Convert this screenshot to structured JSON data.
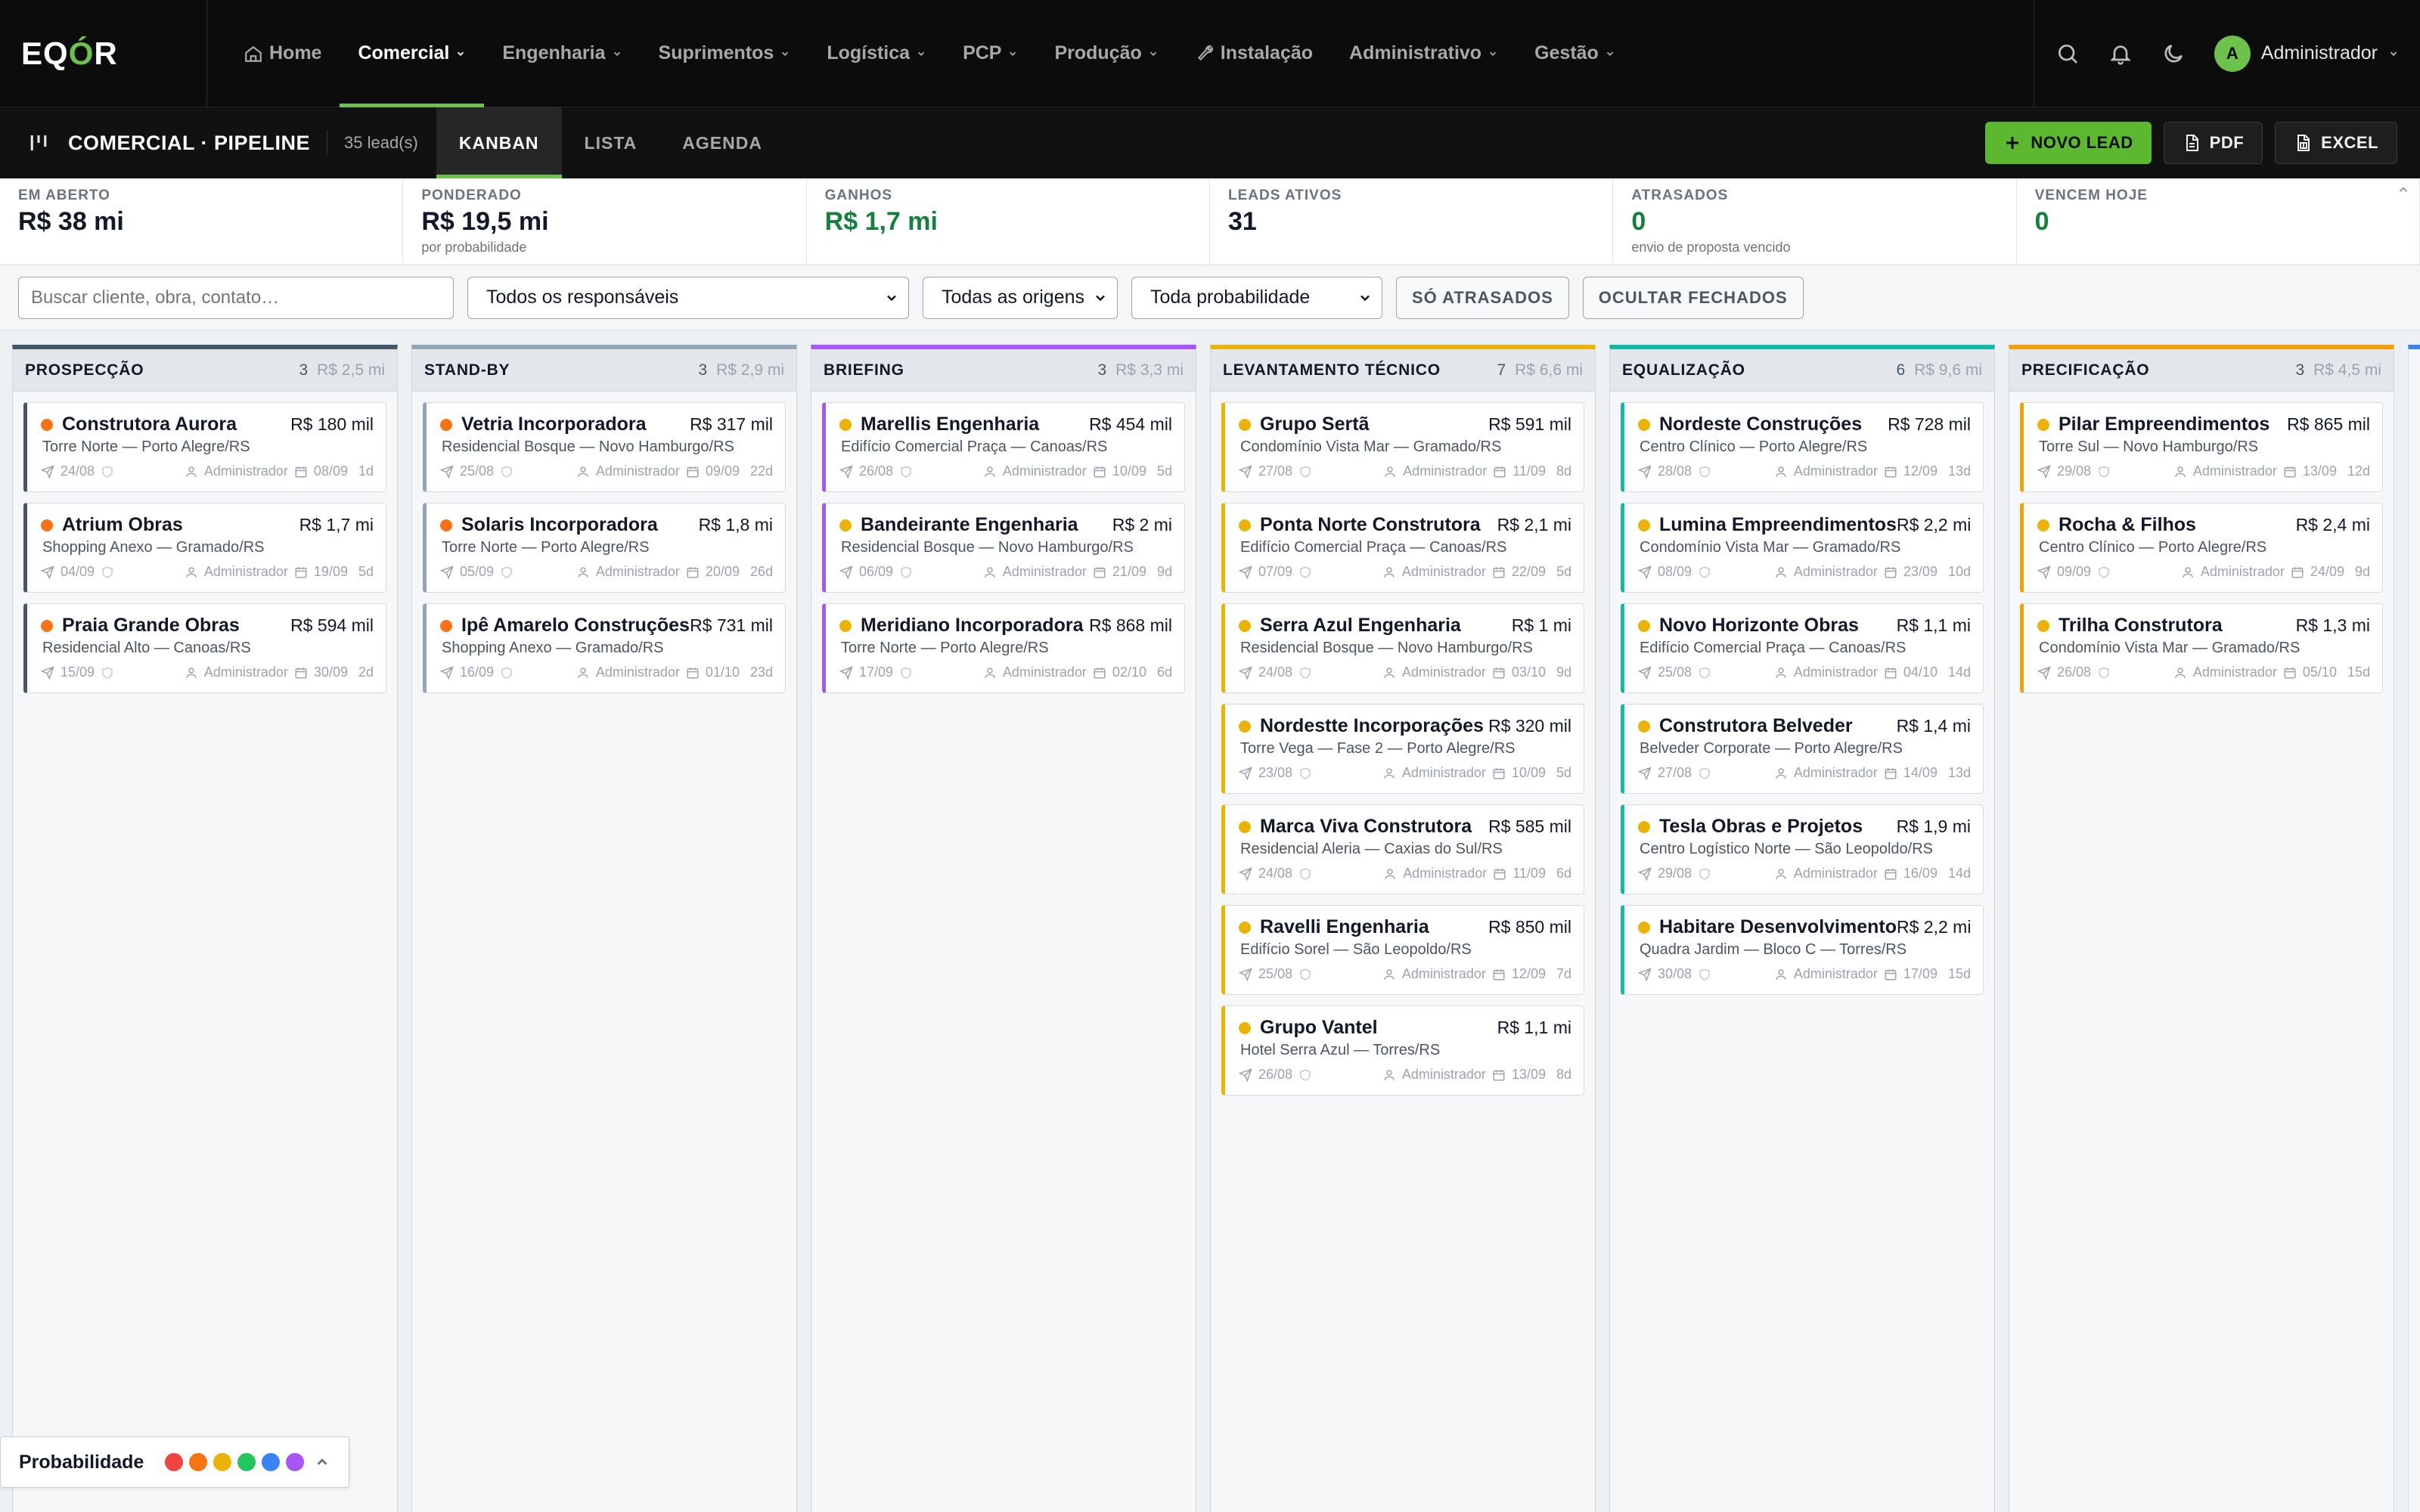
{
  "app": {
    "logo": {
      "part1": "EQ",
      "part2": "Ó",
      "part3": "R"
    },
    "nav": [
      {
        "label": "Home",
        "icon": "home-icon",
        "dropdown": false,
        "active": false
      },
      {
        "label": "Comercial",
        "dropdown": true,
        "active": true
      },
      {
        "label": "Engenharia",
        "dropdown": true,
        "active": false
      },
      {
        "label": "Suprimentos",
        "dropdown": true,
        "active": false
      },
      {
        "label": "Logística",
        "dropdown": true,
        "active": false
      },
      {
        "label": "PCP",
        "dropdown": true,
        "active": false
      },
      {
        "label": "Produção",
        "dropdown": true,
        "active": false
      },
      {
        "label": "Instalação",
        "icon": "wrench-icon",
        "dropdown": false,
        "active": false
      },
      {
        "label": "Administrativo",
        "dropdown": true,
        "active": false
      },
      {
        "label": "Gestão",
        "dropdown": true,
        "active": false
      }
    ],
    "user": {
      "initial": "A",
      "name": "Administrador"
    },
    "accent": "#6cc24a"
  },
  "subheader": {
    "title": "COMERCIAL · PIPELINE",
    "lead_count": "35 lead(s)",
    "tabs": [
      {
        "label": "KANBAN",
        "active": true
      },
      {
        "label": "LISTA",
        "active": false
      },
      {
        "label": "AGENDA",
        "active": false
      }
    ],
    "actions": {
      "new_lead": "NOVO LEAD",
      "pdf": "PDF",
      "excel": "EXCEL"
    }
  },
  "metrics": [
    {
      "label": "EM ABERTO",
      "value": "R$ 38 mi",
      "sub": "",
      "green": false
    },
    {
      "label": "PONDERADO",
      "value": "R$ 19,5 mi",
      "sub": "por probabilidade",
      "green": false
    },
    {
      "label": "GANHOS",
      "value": "R$ 1,7 mi",
      "sub": "",
      "green": true
    },
    {
      "label": "LEADS ATIVOS",
      "value": "31",
      "sub": "",
      "green": false
    },
    {
      "label": "ATRASADOS",
      "value": "0",
      "sub": "envio de proposta vencido",
      "green": true
    },
    {
      "label": "VENCEM HOJE",
      "value": "0",
      "sub": "",
      "green": true
    }
  ],
  "filters": {
    "search_placeholder": "Buscar cliente, obra, contato…",
    "responsaveis": "Todos os responsáveis",
    "origens": "Todas as origens",
    "probabilidade": "Toda probabilidade",
    "atrasados_btn": "SÓ ATRASADOS",
    "fechados_btn": "OCULTAR FECHADOS"
  },
  "columns": [
    {
      "title": "PROSPECÇÃO",
      "count": "3",
      "sum": "R$ 2,5 mi",
      "color": "#475569",
      "cards": [
        {
          "name": "Construtora Aurora",
          "value": "R$ 180 mil",
          "sub": "Torre Norte — Porto Alegre/RS",
          "sent": "24/08",
          "owner": "Administrador",
          "due": "08/09",
          "days": "1d",
          "dot": "#f97316"
        },
        {
          "name": "Atrium Obras",
          "value": "R$ 1,7 mi",
          "sub": "Shopping Anexo — Gramado/RS",
          "sent": "04/09",
          "owner": "Administrador",
          "due": "19/09",
          "days": "5d",
          "dot": "#f97316"
        },
        {
          "name": "Praia Grande Obras",
          "value": "R$ 594 mil",
          "sub": "Residencial Alto — Canoas/RS",
          "sent": "15/09",
          "owner": "Administrador",
          "due": "30/09",
          "days": "2d",
          "dot": "#f97316"
        }
      ]
    },
    {
      "title": "STAND-BY",
      "count": "3",
      "sum": "R$ 2,9 mi",
      "color": "#94a3b8",
      "cards": [
        {
          "name": "Vetria Incorporadora",
          "value": "R$ 317 mil",
          "sub": "Residencial Bosque — Novo Hamburgo/RS",
          "sent": "25/08",
          "owner": "Administrador",
          "due": "09/09",
          "days": "22d",
          "dot": "#f97316"
        },
        {
          "name": "Solaris Incorporadora",
          "value": "R$ 1,8 mi",
          "sub": "Torre Norte — Porto Alegre/RS",
          "sent": "05/09",
          "owner": "Administrador",
          "due": "20/09",
          "days": "26d",
          "dot": "#f97316"
        },
        {
          "name": "Ipê Amarelo Construções",
          "value": "R$ 731 mil",
          "sub": "Shopping Anexo — Gramado/RS",
          "sent": "16/09",
          "owner": "Administrador",
          "due": "01/10",
          "days": "23d",
          "dot": "#f97316"
        }
      ]
    },
    {
      "title": "BRIEFING",
      "count": "3",
      "sum": "R$ 3,3 mi",
      "color": "#a855f7",
      "cards": [
        {
          "name": "Marellis Engenharia",
          "value": "R$ 454 mil",
          "sub": "Edifício Comercial Praça — Canoas/RS",
          "sent": "26/08",
          "owner": "Administrador",
          "due": "10/09",
          "days": "5d",
          "dot": "#eab308"
        },
        {
          "name": "Bandeirante Engenharia",
          "value": "R$ 2 mi",
          "sub": "Residencial Bosque — Novo Hamburgo/RS",
          "sent": "06/09",
          "owner": "Administrador",
          "due": "21/09",
          "days": "9d",
          "dot": "#eab308"
        },
        {
          "name": "Meridiano Incorporadora",
          "value": "R$ 868 mil",
          "sub": "Torre Norte — Porto Alegre/RS",
          "sent": "17/09",
          "owner": "Administrador",
          "due": "02/10",
          "days": "6d",
          "dot": "#eab308"
        }
      ]
    },
    {
      "title": "LEVANTAMENTO TÉCNICO",
      "count": "7",
      "sum": "R$ 6,6 mi",
      "color": "#eab308",
      "cards": [
        {
          "name": "Grupo Sertã",
          "value": "R$ 591 mil",
          "sub": "Condomínio Vista Mar — Gramado/RS",
          "sent": "27/08",
          "owner": "Administrador",
          "due": "11/09",
          "days": "8d",
          "dot": "#eab308"
        },
        {
          "name": "Ponta Norte Construtora",
          "value": "R$ 2,1 mi",
          "sub": "Edifício Comercial Praça — Canoas/RS",
          "sent": "07/09",
          "owner": "Administrador",
          "due": "22/09",
          "days": "5d",
          "dot": "#eab308"
        },
        {
          "name": "Serra Azul Engenharia",
          "value": "R$ 1 mi",
          "sub": "Residencial Bosque — Novo Hamburgo/RS",
          "sent": "24/08",
          "owner": "Administrador",
          "due": "03/10",
          "days": "9d",
          "dot": "#eab308"
        },
        {
          "name": "Nordestte Incorporações",
          "value": "R$ 320 mil",
          "sub": "Torre Vega — Fase 2 — Porto Alegre/RS",
          "sent": "23/08",
          "owner": "Administrador",
          "due": "10/09",
          "days": "5d",
          "dot": "#eab308"
        },
        {
          "name": "Marca Viva Construtora",
          "value": "R$ 585 mil",
          "sub": "Residencial Aleria — Caxias do Sul/RS",
          "sent": "24/08",
          "owner": "Administrador",
          "due": "11/09",
          "days": "6d",
          "dot": "#eab308"
        },
        {
          "name": "Ravelli Engenharia",
          "value": "R$ 850 mil",
          "sub": "Edifício Sorel — São Leopoldo/RS",
          "sent": "25/08",
          "owner": "Administrador",
          "due": "12/09",
          "days": "7d",
          "dot": "#eab308"
        },
        {
          "name": "Grupo Vantel",
          "value": "R$ 1,1 mi",
          "sub": "Hotel Serra Azul — Torres/RS",
          "sent": "26/08",
          "owner": "Administrador",
          "due": "13/09",
          "days": "8d",
          "dot": "#eab308"
        }
      ]
    },
    {
      "title": "EQUALIZAÇÃO",
      "count": "6",
      "sum": "R$ 9,6 mi",
      "color": "#14b8a6",
      "cards": [
        {
          "name": "Nordeste Construções",
          "value": "R$ 728 mil",
          "sub": "Centro Clínico — Porto Alegre/RS",
          "sent": "28/08",
          "owner": "Administrador",
          "due": "12/09",
          "days": "13d",
          "dot": "#eab308"
        },
        {
          "name": "Lumina Empreendimentos",
          "value": "R$ 2,2 mi",
          "sub": "Condomínio Vista Mar — Gramado/RS",
          "sent": "08/09",
          "owner": "Administrador",
          "due": "23/09",
          "days": "10d",
          "dot": "#eab308"
        },
        {
          "name": "Novo Horizonte Obras",
          "value": "R$ 1,1 mi",
          "sub": "Edifício Comercial Praça — Canoas/RS",
          "sent": "25/08",
          "owner": "Administrador",
          "due": "04/10",
          "days": "14d",
          "dot": "#eab308"
        },
        {
          "name": "Construtora Belveder",
          "value": "R$ 1,4 mi",
          "sub": "Belveder Corporate — Porto Alegre/RS",
          "sent": "27/08",
          "owner": "Administrador",
          "due": "14/09",
          "days": "13d",
          "dot": "#eab308"
        },
        {
          "name": "Tesla Obras e Projetos",
          "value": "R$ 1,9 mi",
          "sub": "Centro Logístico Norte — São Leopoldo/RS",
          "sent": "29/08",
          "owner": "Administrador",
          "due": "16/09",
          "days": "14d",
          "dot": "#eab308"
        },
        {
          "name": "Habitare Desenvolvimento",
          "value": "R$ 2,2 mi",
          "sub": "Quadra Jardim — Bloco C — Torres/RS",
          "sent": "30/08",
          "owner": "Administrador",
          "due": "17/09",
          "days": "15d",
          "dot": "#eab308"
        }
      ]
    },
    {
      "title": "PRECIFICAÇÃO",
      "count": "3",
      "sum": "R$ 4,5 mi",
      "color": "#f59e0b",
      "cards": [
        {
          "name": "Pilar Empreendimentos",
          "value": "R$ 865 mil",
          "sub": "Torre Sul — Novo Hamburgo/RS",
          "sent": "29/08",
          "owner": "Administrador",
          "due": "13/09",
          "days": "12d",
          "dot": "#eab308"
        },
        {
          "name": "Rocha & Filhos",
          "value": "R$ 2,4 mi",
          "sub": "Centro Clínico — Porto Alegre/RS",
          "sent": "09/09",
          "owner": "Administrador",
          "due": "24/09",
          "days": "9d",
          "dot": "#eab308"
        },
        {
          "name": "Trilha Construtora",
          "value": "R$ 1,3 mi",
          "sub": "Condomínio Vista Mar — Gramado/RS",
          "sent": "26/08",
          "owner": "Administrador",
          "due": "05/10",
          "days": "15d",
          "dot": "#eab308"
        }
      ]
    }
  ],
  "legend": {
    "label": "Probabilidade",
    "colors": [
      "#ef4444",
      "#f97316",
      "#eab308",
      "#22c55e",
      "#3b82f6",
      "#a855f7"
    ]
  }
}
